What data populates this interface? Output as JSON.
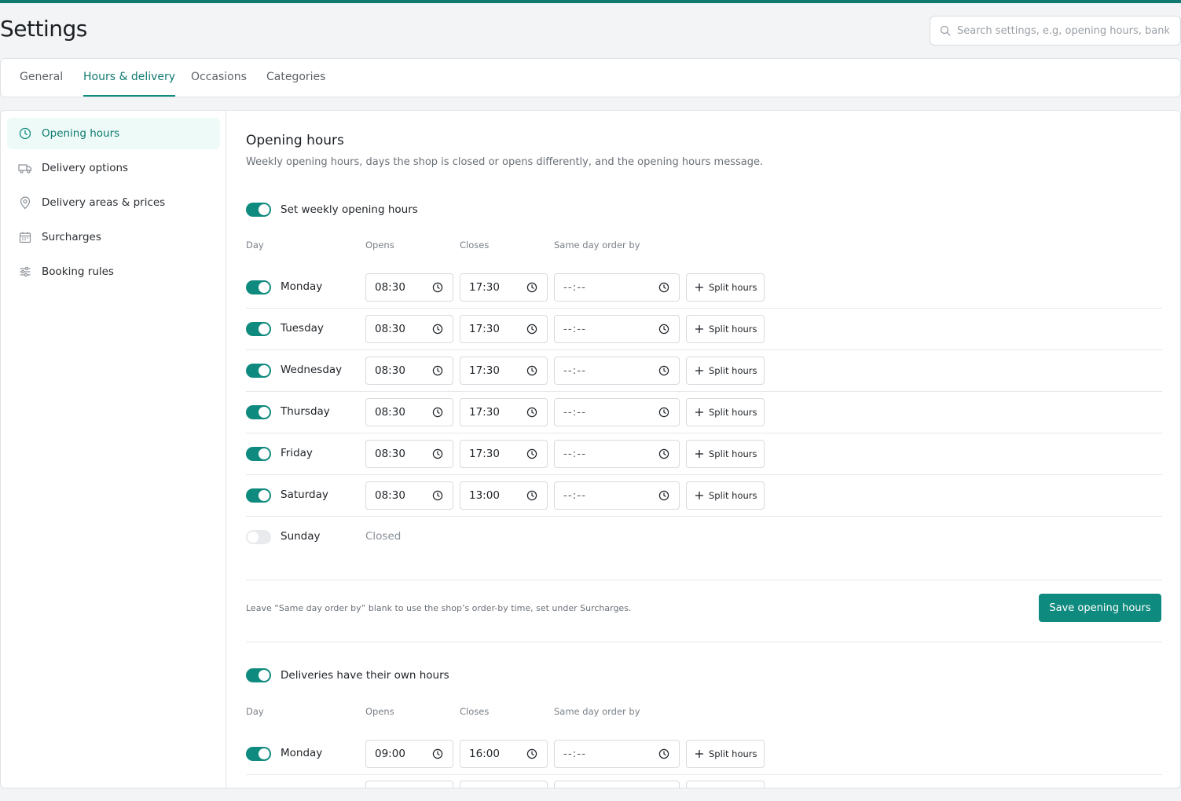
{
  "page": {
    "title": "Settings",
    "search_placeholder": "Search settings, e.g, opening hours, bank c",
    "accent_color": "#0f8a7e"
  },
  "tabs": [
    {
      "label": "General",
      "active": false
    },
    {
      "label": "Hours & delivery",
      "active": true
    },
    {
      "label": "Occasions",
      "active": false
    },
    {
      "label": "Categories",
      "active": false
    }
  ],
  "sidebar": {
    "items": [
      {
        "label": "Opening hours",
        "icon": "clock-icon",
        "active": true
      },
      {
        "label": "Delivery options",
        "icon": "truck-icon",
        "active": false
      },
      {
        "label": "Delivery areas & prices",
        "icon": "location-pin-icon",
        "active": false
      },
      {
        "label": "Surcharges",
        "icon": "calendar-icon",
        "active": false
      },
      {
        "label": "Booking rules",
        "icon": "sliders-icon",
        "active": false
      }
    ]
  },
  "opening": {
    "title": "Opening hours",
    "description": "Weekly opening hours, days the shop is closed or opens differently, and the opening hours message.",
    "weekly_toggle_label": "Set weekly opening hours",
    "weekly_toggle_on": true,
    "columns": {
      "day": "Day",
      "opens": "Opens",
      "closes": "Closes",
      "same_day": "Same day order by"
    },
    "split_label": "Split hours",
    "empty_time": "--:--",
    "closed_label": "Closed",
    "days": [
      {
        "day": "Monday",
        "on": true,
        "opens": "08:30",
        "closes": "17:30"
      },
      {
        "day": "Tuesday",
        "on": true,
        "opens": "08:30",
        "closes": "17:30"
      },
      {
        "day": "Wednesday",
        "on": true,
        "opens": "08:30",
        "closes": "17:30"
      },
      {
        "day": "Thursday",
        "on": true,
        "opens": "08:30",
        "closes": "17:30"
      },
      {
        "day": "Friday",
        "on": true,
        "opens": "08:30",
        "closes": "17:30"
      },
      {
        "day": "Saturday",
        "on": true,
        "opens": "08:30",
        "closes": "13:00"
      },
      {
        "day": "Sunday",
        "on": false,
        "opens": "",
        "closes": ""
      }
    ],
    "hint": "Leave “Same day order by” blank to use the shop’s order-by time, set under Surcharges.",
    "save_label": "Save opening hours"
  },
  "delivery": {
    "toggle_label": "Deliveries have their own hours",
    "toggle_on": true,
    "columns": {
      "day": "Day",
      "opens": "Opens",
      "closes": "Closes",
      "same_day": "Same day order by"
    },
    "days": [
      {
        "day": "Monday",
        "on": true,
        "opens": "09:00",
        "closes": "16:00"
      }
    ]
  }
}
